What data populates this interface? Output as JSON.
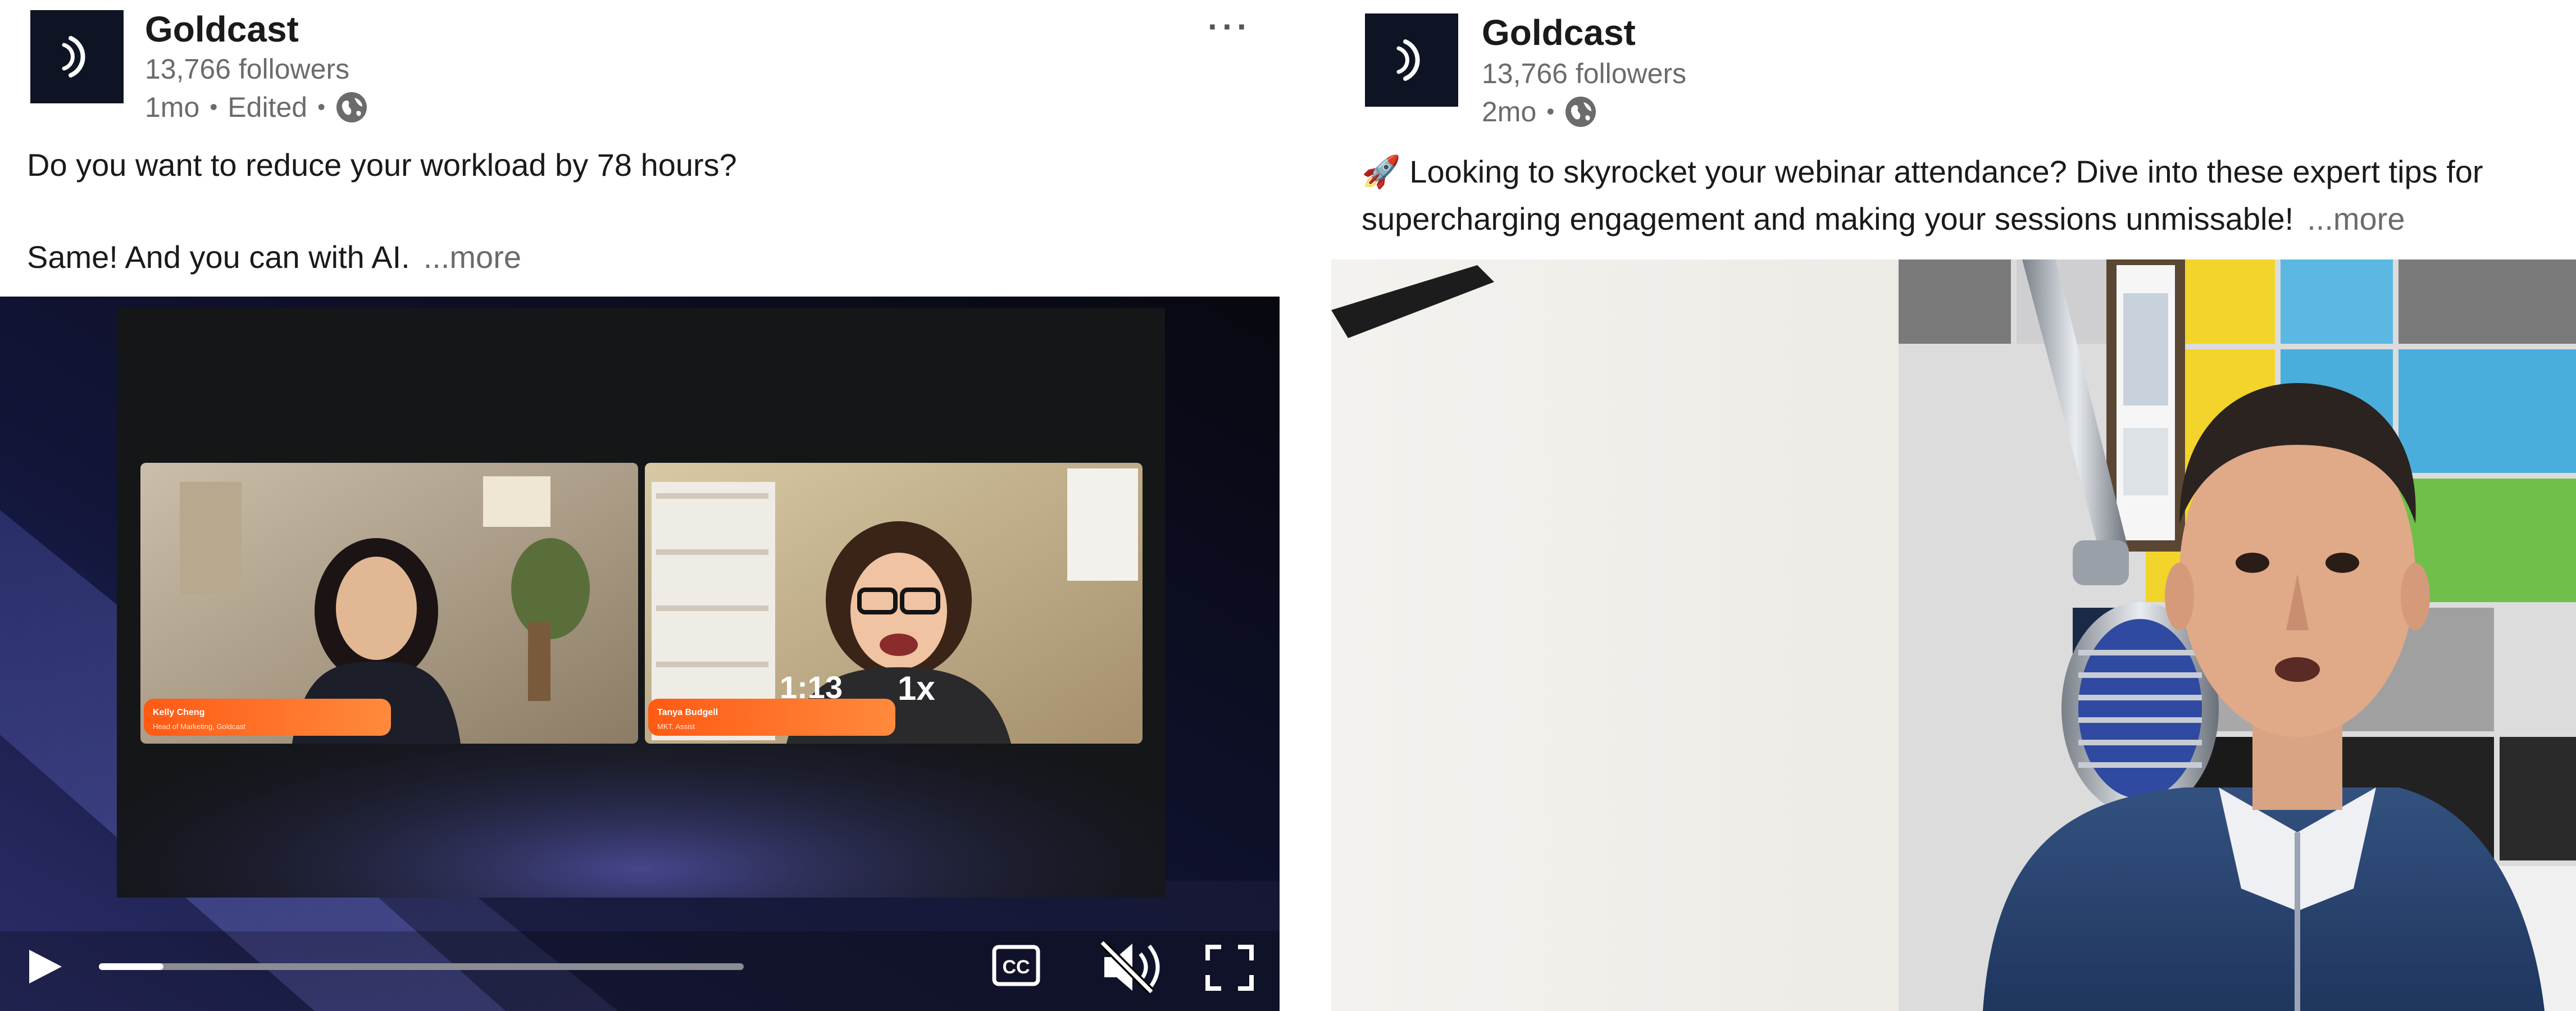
{
  "posts": [
    {
      "company": "Goldcast",
      "followers": "13,766 followers",
      "age": "1mo",
      "edited": "Edited",
      "visibility_icon": "globe-icon",
      "overflow_menu_label": "···",
      "text_line1": "Do you want to reduce your workload by 78 hours?",
      "text_line2": "Same! And you can with AI.",
      "more_label": "...more",
      "video": {
        "speakers": [
          {
            "name": "Kelly Cheng",
            "title": "Head of Marketing, Goldcast"
          },
          {
            "name": "Tanya Budgell",
            "title": "MKT. Assist"
          }
        ],
        "time": "1:13",
        "speed": "1x",
        "progress_fraction": 0.1,
        "icons": [
          "play-icon",
          "cc-icon",
          "muted-icon",
          "fullscreen-icon"
        ]
      }
    },
    {
      "company": "Goldcast",
      "followers": "13,766 followers",
      "age": "2mo",
      "visibility_icon": "globe-icon",
      "text_emoji": "🚀",
      "text_line1": "Looking to skyrocket your webinar attendance? Dive into these expert tips for",
      "text_line2": "supercharging engagement and making your sessions unmissable!",
      "more_label": "...more"
    }
  ],
  "colors": {
    "logo_bg": "#0f1424",
    "meta_text": "#6b6b6b",
    "lower_third": "#ff6b1a",
    "video_bg": "#0b0d1e"
  }
}
